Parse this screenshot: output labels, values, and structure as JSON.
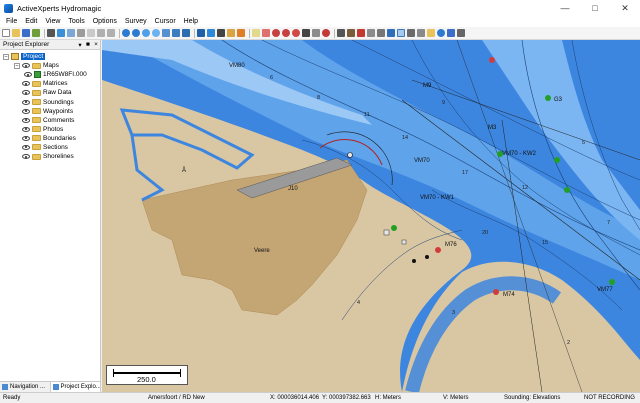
{
  "window": {
    "title": "ActiveXperts Hydromagic"
  },
  "menu": [
    "File",
    "Edit",
    "View",
    "Tools",
    "Options",
    "Survey",
    "Cursor",
    "Help"
  ],
  "explorer": {
    "title": "Project Explorer",
    "pin": "↑",
    "pin2": "✕",
    "close": "×",
    "project": "Project",
    "maps": "Maps",
    "map_file": "1R65W8FI.000",
    "folders": [
      "Matrices",
      "Raw Data",
      "Soundings",
      "Waypoints",
      "Comments",
      "Photos",
      "Boundaries",
      "Sections",
      "Shorelines"
    ],
    "tabs": [
      "Navigation ...",
      "Project Explo..."
    ]
  },
  "map": {
    "scale": "250.0",
    "labels": {
      "veere": "Veere",
      "vm70": "VM70",
      "vm70kw1": "VM70 - KW1",
      "m76": "M76",
      "m74": "M74",
      "vm77": "VM77",
      "g3": "G3",
      "vm70kw2": "VM70 - KW2",
      "m3": "M3",
      "vm9": "M9",
      "vm80": "VM80",
      "j10": "J10",
      "ms": "Å"
    }
  },
  "status": {
    "ready": "Ready",
    "projection": "Amersfoort / RD New",
    "x": "X: 000036014.406",
    "y": "Y: 000397382.663",
    "h": "H: Meters",
    "v": "V: Meters",
    "sounding": "Sounding: Elevations",
    "recording": "NOT RECORDING"
  }
}
